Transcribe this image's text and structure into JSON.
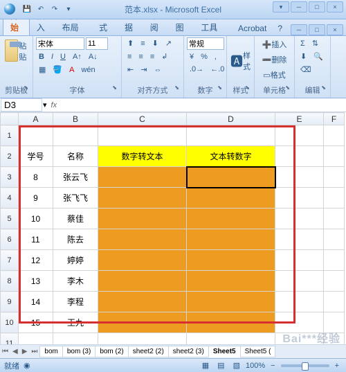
{
  "window": {
    "title": "范本.xlsx - Microsoft Excel"
  },
  "tabs": {
    "active": "开始",
    "items": [
      "开始",
      "插入",
      "页面布局",
      "公式",
      "数据",
      "审阅",
      "视图",
      "开发工具",
      "Acrobat"
    ]
  },
  "ribbon": {
    "clipboard": {
      "label": "剪贴板",
      "paste": "粘贴"
    },
    "font": {
      "label": "字体",
      "name": "宋体",
      "size": "11"
    },
    "align": {
      "label": "对齐方式"
    },
    "number": {
      "label": "数字",
      "format": "常规"
    },
    "styles": {
      "label": "样式",
      "fmt": "样式"
    },
    "cells": {
      "label": "单元格",
      "insert": "插入",
      "delete": "删除",
      "format": "格式"
    },
    "editing": {
      "label": "编辑"
    }
  },
  "formula": {
    "namebox": "D3",
    "value": ""
  },
  "cols": [
    "",
    "A",
    "B",
    "C",
    "D",
    "E",
    "F"
  ],
  "table": {
    "headers": {
      "a": "学号",
      "b": "名称",
      "c": "数字转文本",
      "d": "文本转数字"
    },
    "rows": [
      {
        "n": "8",
        "name": "张云飞"
      },
      {
        "n": "9",
        "name": "张飞飞"
      },
      {
        "n": "10",
        "name": "蔡佳"
      },
      {
        "n": "11",
        "name": "陈去"
      },
      {
        "n": "12",
        "name": "婷婷"
      },
      {
        "n": "13",
        "name": "李木"
      },
      {
        "n": "14",
        "name": "李程"
      },
      {
        "n": "15",
        "name": "王九"
      }
    ]
  },
  "sheets": {
    "items": [
      "bom",
      "bom (3)",
      "bom (2)",
      "sheet2 (2)",
      "sheet2 (3)",
      "Sheet5",
      "Sheet5 ("
    ],
    "active": "Sheet5"
  },
  "status": {
    "mode": "就绪",
    "zoom": "100%",
    "minus": "−",
    "plus": "+"
  },
  "icons": {
    "min": "─",
    "max": "□",
    "close": "×",
    "dd": "▾",
    "help": "?"
  },
  "watermark": "Bai***经验"
}
